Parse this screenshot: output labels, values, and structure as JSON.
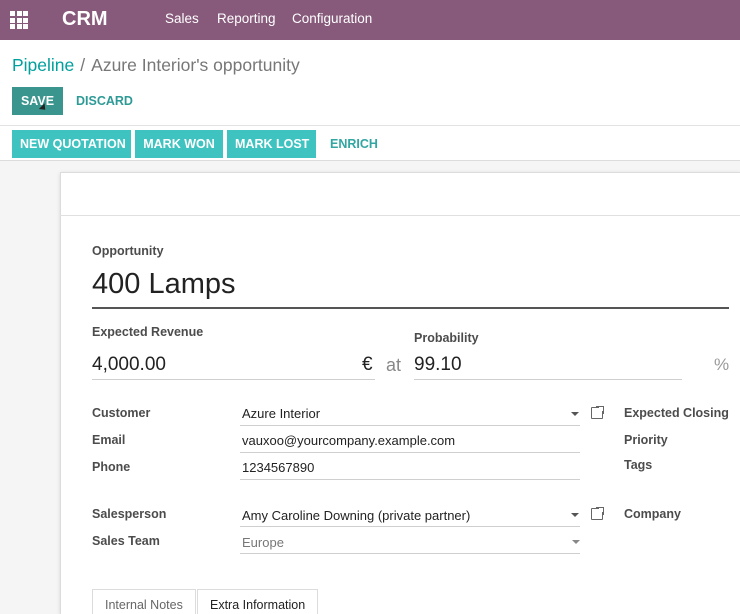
{
  "navbar": {
    "brand": "CRM",
    "menu": [
      "Sales",
      "Reporting",
      "Configuration"
    ]
  },
  "breadcrumb": {
    "parent": "Pipeline",
    "separator": "/",
    "current": "Azure Interior's opportunity"
  },
  "control": {
    "save": "SAVE",
    "discard": "DISCARD"
  },
  "status_buttons": [
    "NEW QUOTATION",
    "MARK WON",
    "MARK LOST",
    "ENRICH"
  ],
  "form": {
    "opportunity_label": "Opportunity",
    "opportunity_name": "400 Lamps",
    "expected_revenue_label": "Expected Revenue",
    "expected_revenue": "4,000.00",
    "currency_symbol": "€",
    "at_text": "at",
    "probability_label": "Probability",
    "probability": "99.10",
    "percent_symbol": "%",
    "customer_label": "Customer",
    "customer": "Azure Interior",
    "email_label": "Email",
    "email": "vauxoo@yourcompany.example.com",
    "phone_label": "Phone",
    "phone": "1234567890",
    "salesperson_label": "Salesperson",
    "salesperson": "Amy Caroline Downing (private partner)",
    "sales_team_label": "Sales Team",
    "sales_team": "Europe",
    "expected_closing_label": "Expected Closing",
    "priority_label": "Priority",
    "tags_label": "Tags",
    "company_label": "Company"
  },
  "tabs": [
    "Internal Notes",
    "Extra Information"
  ],
  "colors": {
    "navbar": "#875a7b",
    "primary": "#00a09d",
    "status_button": "#3fc3c0"
  }
}
